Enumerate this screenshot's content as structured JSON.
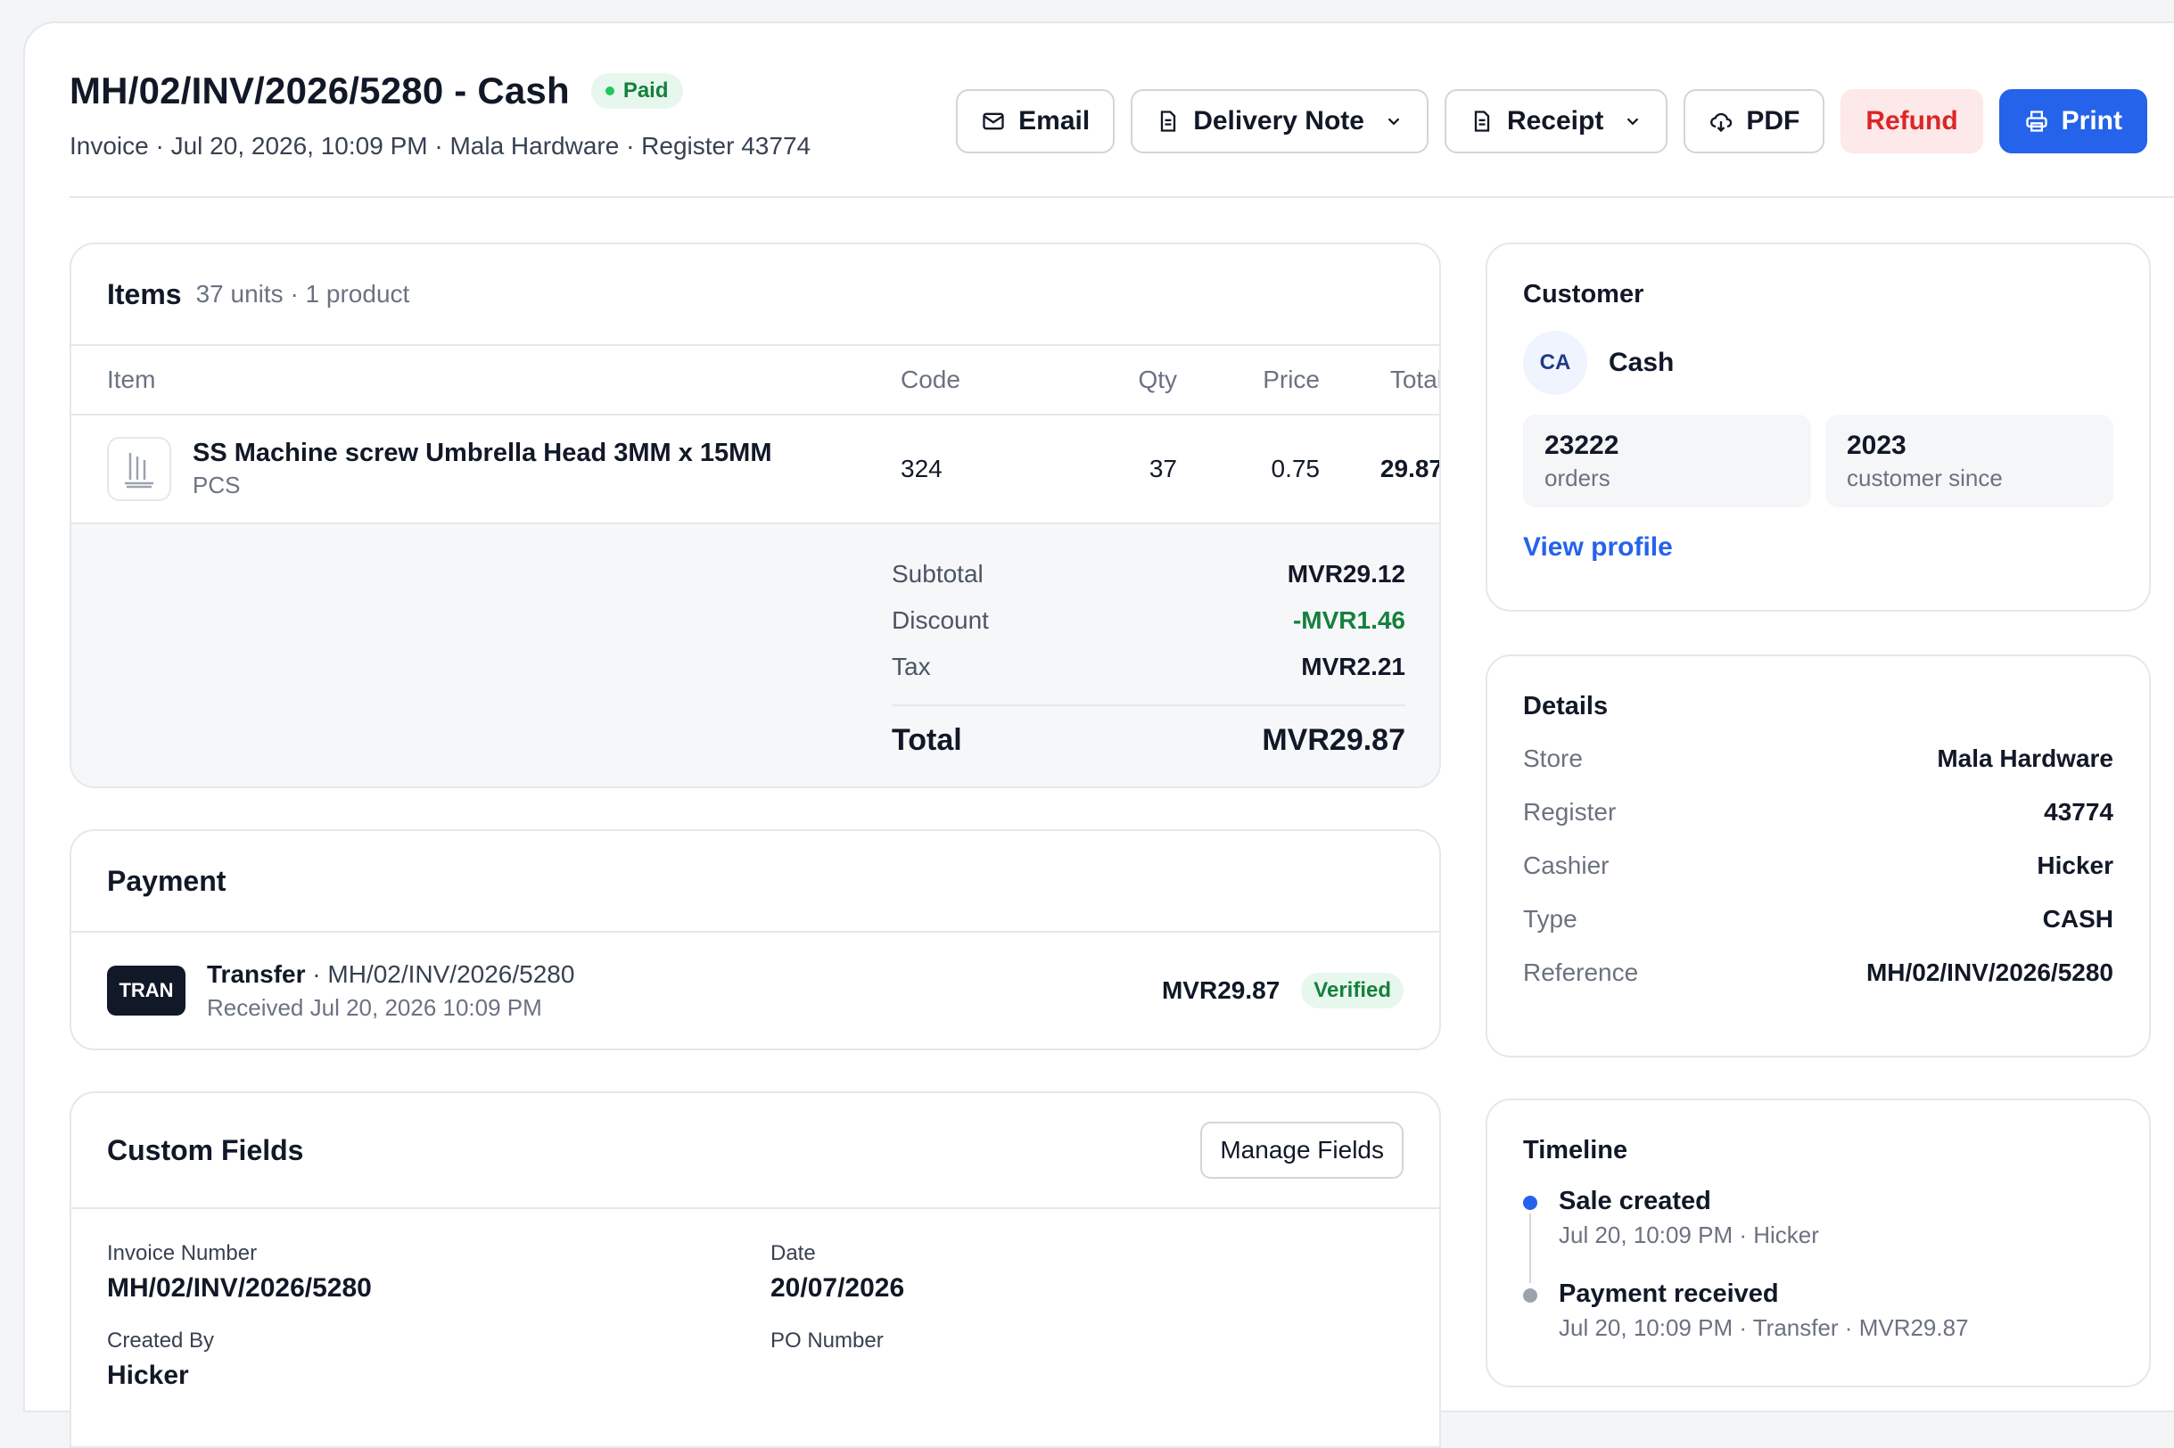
{
  "header": {
    "title": "MH/02/INV/2026/5280 - Cash",
    "status": "Paid",
    "subtitle": "Invoice · Jul 20, 2026, 10:09 PM · Mala Hardware · Register 43774",
    "actions": {
      "email": "Email",
      "delivery_note": "Delivery Note",
      "receipt": "Receipt",
      "pdf": "PDF",
      "refund": "Refund",
      "print": "Print"
    }
  },
  "items": {
    "title": "Items",
    "summary": "37 units · 1 product",
    "columns": {
      "item": "Item",
      "code": "Code",
      "qty": "Qty",
      "price": "Price",
      "total": "Total"
    },
    "rows": [
      {
        "name": "SS Machine screw Umbrella Head 3MM x 15MM",
        "unit": "PCS",
        "code": "324",
        "qty": "37",
        "price": "0.75",
        "total": "29.87"
      }
    ],
    "totals": {
      "subtotal_label": "Subtotal",
      "subtotal": "MVR29.12",
      "discount_label": "Discount",
      "discount": "-MVR1.46",
      "tax_label": "Tax",
      "tax": "MVR2.21",
      "total_label": "Total",
      "total": "MVR29.87"
    }
  },
  "payment": {
    "title": "Payment",
    "method_badge": "TRAN",
    "method": "Transfer",
    "reference": " · MH/02/INV/2026/5280",
    "received": "Received Jul 20, 2026 10:09 PM",
    "amount": "MVR29.87",
    "status": "Verified"
  },
  "custom_fields": {
    "title": "Custom Fields",
    "manage_label": "Manage Fields",
    "fields": [
      {
        "label": "Invoice Number",
        "value": "MH/02/INV/2026/5280"
      },
      {
        "label": "Date",
        "value": "20/07/2026"
      },
      {
        "label": "Created By",
        "value": "Hicker"
      },
      {
        "label": "PO Number",
        "value": ""
      }
    ]
  },
  "customer": {
    "title": "Customer",
    "initials": "CA",
    "name": "Cash",
    "orders_value": "23222",
    "orders_label": "orders",
    "since_value": "2023",
    "since_label": "customer since",
    "link": "View profile"
  },
  "details": {
    "title": "Details",
    "rows": [
      {
        "k": "Store",
        "v": "Mala Hardware"
      },
      {
        "k": "Register",
        "v": "43774"
      },
      {
        "k": "Cashier",
        "v": "Hicker"
      },
      {
        "k": "Type",
        "v": "CASH"
      },
      {
        "k": "Reference",
        "v": "MH/02/INV/2026/5280"
      }
    ]
  },
  "timeline": {
    "title": "Timeline",
    "events": [
      {
        "title": "Sale created",
        "sub": "Jul 20, 10:09 PM · Hicker",
        "color": "#2563eb"
      },
      {
        "title": "Payment received",
        "sub": "Jul 20, 10:09 PM · Transfer · MVR29.87",
        "color": "#9ca3af"
      }
    ]
  },
  "colors": {
    "accent": "#2563eb",
    "success": "#15803d",
    "danger": "#dc2626"
  }
}
